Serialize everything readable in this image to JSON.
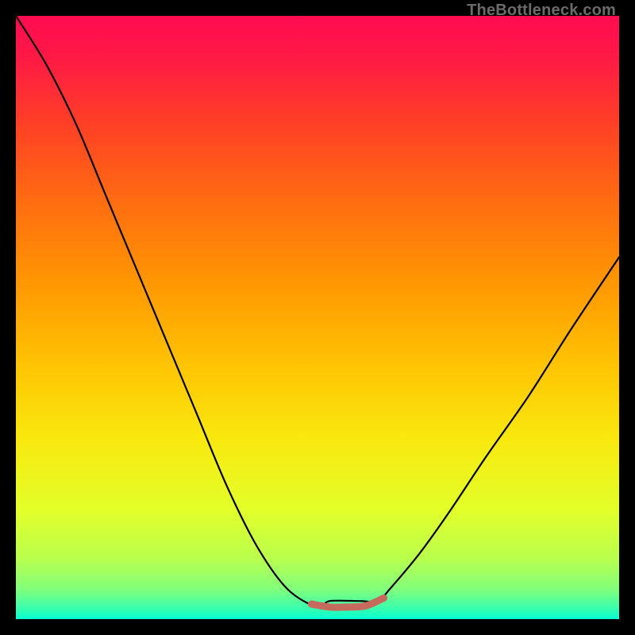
{
  "watermark": "TheBottleneck.com",
  "colors": {
    "frame": "#000000",
    "gradient_stops": [
      {
        "offset": 0.0,
        "color": "#ff0b51"
      },
      {
        "offset": 0.07,
        "color": "#ff1a45"
      },
      {
        "offset": 0.18,
        "color": "#ff4026"
      },
      {
        "offset": 0.3,
        "color": "#ff6a12"
      },
      {
        "offset": 0.44,
        "color": "#ff9602"
      },
      {
        "offset": 0.58,
        "color": "#ffc403"
      },
      {
        "offset": 0.7,
        "color": "#f9e80e"
      },
      {
        "offset": 0.82,
        "color": "#e3ff2a"
      },
      {
        "offset": 0.9,
        "color": "#b9ff4e"
      },
      {
        "offset": 0.95,
        "color": "#82ff7b"
      },
      {
        "offset": 0.98,
        "color": "#3effab"
      },
      {
        "offset": 1.0,
        "color": "#06ffd2"
      }
    ],
    "curve": "#000000",
    "flat_segment": "#c66a5e"
  },
  "chart_data": {
    "type": "line",
    "title": "",
    "xlabel": "",
    "ylabel": "",
    "xlim": [
      0,
      100
    ],
    "ylim": [
      0,
      100
    ],
    "series": [
      {
        "name": "bottleneck-curve",
        "points": [
          {
            "x": 0,
            "y": 100
          },
          {
            "x": 5,
            "y": 92
          },
          {
            "x": 10,
            "y": 82
          },
          {
            "x": 15,
            "y": 70
          },
          {
            "x": 20,
            "y": 58
          },
          {
            "x": 25,
            "y": 46
          },
          {
            "x": 30,
            "y": 34
          },
          {
            "x": 35,
            "y": 22
          },
          {
            "x": 40,
            "y": 12
          },
          {
            "x": 45,
            "y": 5
          },
          {
            "x": 50,
            "y": 2
          },
          {
            "x": 52,
            "y": 3
          },
          {
            "x": 57,
            "y": 3
          },
          {
            "x": 60,
            "y": 3
          },
          {
            "x": 62,
            "y": 5
          },
          {
            "x": 67,
            "y": 11
          },
          {
            "x": 72,
            "y": 18
          },
          {
            "x": 78,
            "y": 27
          },
          {
            "x": 85,
            "y": 37
          },
          {
            "x": 92,
            "y": 48
          },
          {
            "x": 100,
            "y": 60
          }
        ]
      },
      {
        "name": "flat-segment",
        "points": [
          {
            "x": 49,
            "y": 2.5
          },
          {
            "x": 52,
            "y": 2.0
          },
          {
            "x": 55,
            "y": 2.0
          },
          {
            "x": 58,
            "y": 2.2
          },
          {
            "x": 61,
            "y": 3.5
          }
        ]
      }
    ]
  }
}
